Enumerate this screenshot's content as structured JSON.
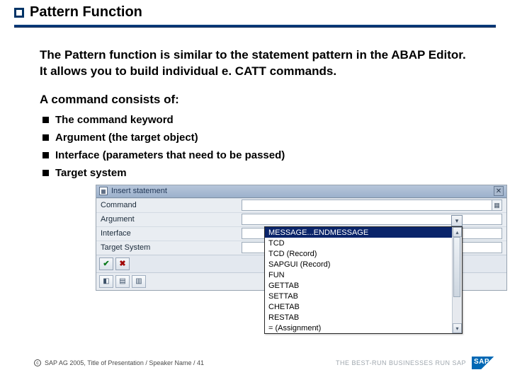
{
  "title": "Pattern Function",
  "intro": "The Pattern function is similar to the statement pattern in the ABAP Editor. It allows you to build individual e. CATT commands.",
  "subhead": "A command consists of:",
  "bullets": [
    "The command keyword",
    "Argument (the target object)",
    "Interface (parameters that need to be passed)",
    "Target system"
  ],
  "dialog": {
    "title": "Insert statement",
    "labels": {
      "command": "Command",
      "argument": "Argument",
      "interface": "Interface",
      "target": "Target System"
    }
  },
  "dropdown": {
    "options": [
      "MESSAGE...ENDMESSAGE",
      "TCD",
      "TCD (Record)",
      "SAPGUI (Record)",
      "FUN",
      "GETTAB",
      "SETTAB",
      "CHETAB",
      "RESTAB",
      "= (Assignment)"
    ],
    "selected_index": 0
  },
  "footer": {
    "text": "SAP AG 2005, Title of Presentation / Speaker Name / 41",
    "tagline": "THE BEST-RUN BUSINESSES RUN SAP",
    "logo": "SAP"
  }
}
